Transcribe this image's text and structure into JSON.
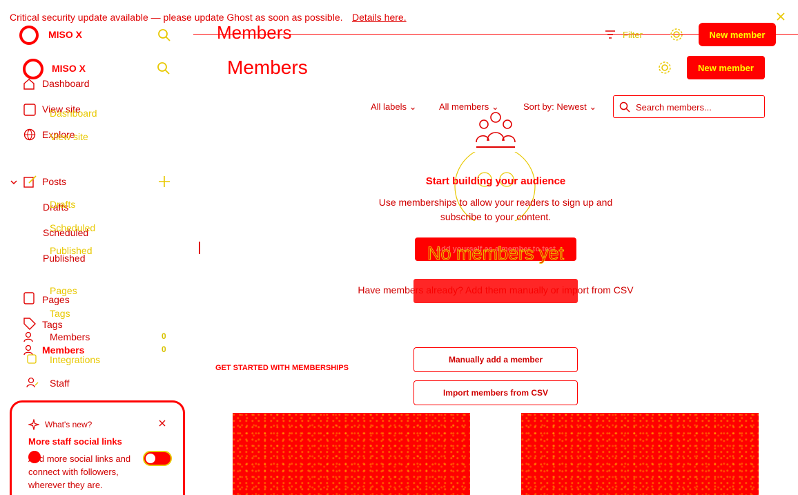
{
  "banner": {
    "text": "Critical security update available — please update Ghost as soon as possible.",
    "link": "Details here."
  },
  "site": {
    "name": "MISO X"
  },
  "sidebar": {
    "items": {
      "dashboard": "Dashboard",
      "view_site": "View site",
      "explore": "Explore",
      "posts": "Posts",
      "drafts": "Drafts",
      "scheduled": "Scheduled",
      "published": "Published",
      "pages": "Pages",
      "tags": "Tags",
      "members": "Members",
      "members_count": "0",
      "integrations": "Integrations",
      "staff": "Staff"
    },
    "whats_new": {
      "label": "What's new?",
      "title": "More staff social links",
      "body": "Add more social links and connect with followers, wherever they are."
    }
  },
  "header": {
    "title": "Members",
    "filter": "Filter",
    "new_member": "New member"
  },
  "filters": {
    "labels": "All labels",
    "members": "All members",
    "sort": "Sort by: Newest",
    "search_placeholder": "Search members..."
  },
  "empty_state": {
    "title": "Start building your audience",
    "body": "Use memberships to allow your readers to sign up and subscribe to your content.",
    "add_yourself": "Add yourself as a member to test",
    "no_members": "No members yet",
    "have_members": "Have members already? Add them manually or import from CSV"
  },
  "get_started": {
    "heading": "GET STARTED WITH MEMBERSHIPS",
    "manual": "Manually add a member",
    "import": "Import members from CSV"
  }
}
